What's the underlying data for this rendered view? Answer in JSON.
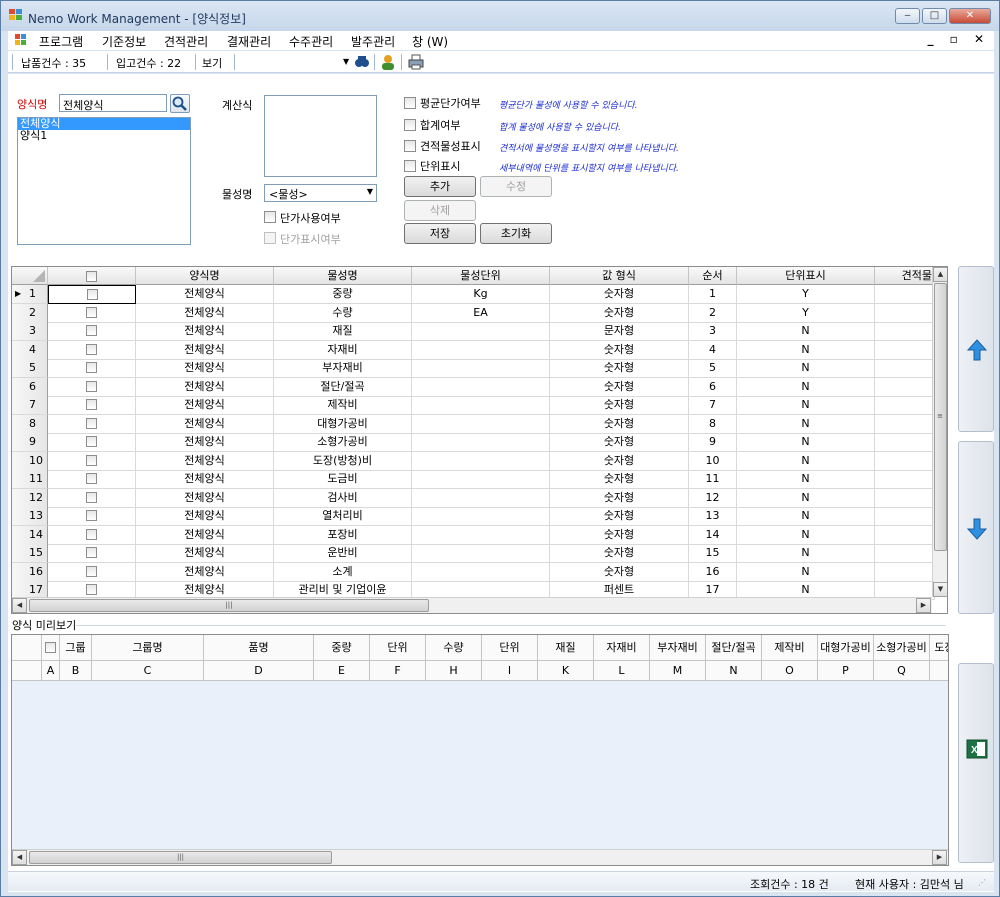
{
  "window": {
    "title": "Nemo Work Management - [양식정보]",
    "min": "‒",
    "max": "□",
    "close": "✕"
  },
  "menu": {
    "items": [
      "프로그램",
      "기준정보",
      "견적관리",
      "결재관리",
      "수주관리",
      "발주관리",
      "창 (W)"
    ],
    "mdi": "_ ▫ ✕"
  },
  "toolbar": {
    "delivery_count": "납품건수 : 35",
    "receipt_count": "입고건수 : 22",
    "view_label": "보기"
  },
  "form": {
    "form_name_label": "양식명",
    "form_name_value": "전체양식",
    "form_list": [
      "전체양식",
      "양식1"
    ],
    "formula_label": "계산식",
    "attr_label": "물성명",
    "attr_combo": "<물성>",
    "unit_price_use": "단가사용여부",
    "unit_price_display": "단가표시여부",
    "options": [
      {
        "label": "평균단가여부",
        "desc": "평균단가 물성에 사용할 수 있습니다."
      },
      {
        "label": "합계여부",
        "desc": "합계 물성에 사용할 수 있습니다."
      },
      {
        "label": "견적물성표시",
        "desc": "견적서에 물성명을 표시할지 여부를 나타냅니다."
      },
      {
        "label": "단위표시",
        "desc": "세부내역에 단위를 표시할지 여부를 나타냅니다."
      }
    ],
    "buttons": {
      "add": "추가",
      "edit": "수정",
      "delete": "삭제",
      "save": "저장",
      "reset": "초기화"
    }
  },
  "grid": {
    "columns": [
      "양식명",
      "물성명",
      "물성단위",
      "값 형식",
      "순서",
      "단위표시",
      "견적물"
    ],
    "rows": [
      [
        "1",
        "전체양식",
        "중량",
        "Kg",
        "숫자형",
        "1",
        "Y"
      ],
      [
        "2",
        "전체양식",
        "수량",
        "EA",
        "숫자형",
        "2",
        "Y"
      ],
      [
        "3",
        "전체양식",
        "재질",
        "",
        "문자형",
        "3",
        "N"
      ],
      [
        "4",
        "전체양식",
        "자재비",
        "",
        "숫자형",
        "4",
        "N"
      ],
      [
        "5",
        "전체양식",
        "부자재비",
        "",
        "숫자형",
        "5",
        "N"
      ],
      [
        "6",
        "전체양식",
        "절단/절곡",
        "",
        "숫자형",
        "6",
        "N"
      ],
      [
        "7",
        "전체양식",
        "제작비",
        "",
        "숫자형",
        "7",
        "N"
      ],
      [
        "8",
        "전체양식",
        "대형가공비",
        "",
        "숫자형",
        "8",
        "N"
      ],
      [
        "9",
        "전체양식",
        "소형가공비",
        "",
        "숫자형",
        "9",
        "N"
      ],
      [
        "10",
        "전체양식",
        "도장(방청)비",
        "",
        "숫자형",
        "10",
        "N"
      ],
      [
        "11",
        "전체양식",
        "도금비",
        "",
        "숫자형",
        "11",
        "N"
      ],
      [
        "12",
        "전체양식",
        "검사비",
        "",
        "숫자형",
        "12",
        "N"
      ],
      [
        "13",
        "전체양식",
        "열처리비",
        "",
        "숫자형",
        "13",
        "N"
      ],
      [
        "14",
        "전체양식",
        "포장비",
        "",
        "숫자형",
        "14",
        "N"
      ],
      [
        "15",
        "전체양식",
        "운반비",
        "",
        "숫자형",
        "15",
        "N"
      ],
      [
        "16",
        "전체양식",
        "소계",
        "",
        "숫자형",
        "16",
        "N"
      ],
      [
        "17",
        "전체양식",
        "관리비 및 기업이윤",
        "",
        "퍼센트",
        "17",
        "N"
      ]
    ]
  },
  "preview": {
    "title": "양식 미리보기",
    "headers": [
      "그룹",
      "그룹명",
      "품명",
      "중량",
      "단위",
      "수량",
      "단위",
      "재질",
      "자재비",
      "부자재비",
      "절단/절곡",
      "제작비",
      "대형가공비",
      "소형가공비",
      "도장"
    ],
    "letters": [
      "A",
      "B",
      "C",
      "D",
      "E",
      "F",
      "H",
      "I",
      "K",
      "L",
      "M",
      "N",
      "O",
      "P",
      "Q"
    ]
  },
  "status": {
    "count": "조회건수 : 18 건",
    "user": "현재 사용자 : 김만석 님"
  }
}
